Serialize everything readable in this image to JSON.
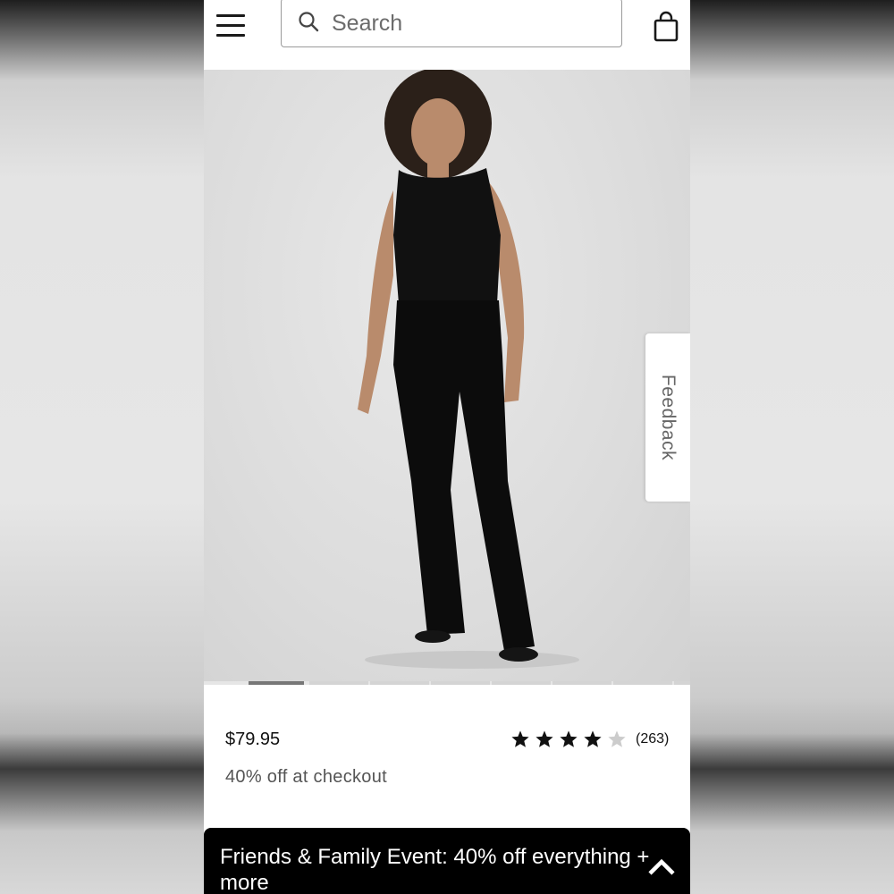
{
  "header": {
    "menu_icon": "hamburger-menu-icon",
    "search": {
      "placeholder": "Search",
      "icon": "search-icon"
    },
    "bag_icon": "shopping-bag-icon"
  },
  "product": {
    "image_description": "Model wearing black sleeveless top and black flared pants",
    "carousel_total": 8,
    "carousel_active_index": 0,
    "price": "$79.95",
    "promo": "40% off at checkout",
    "rating": {
      "stars": 4,
      "max": 5,
      "count_label": "(263)"
    }
  },
  "feedback": {
    "label": "Feedback"
  },
  "banner": {
    "text": "Friends & Family Event: 40% off everything + more",
    "icon": "chevron-up-icon"
  },
  "colors": {
    "banner_bg": "#000000",
    "star_filled": "#111111",
    "star_empty": "#cccccc"
  }
}
